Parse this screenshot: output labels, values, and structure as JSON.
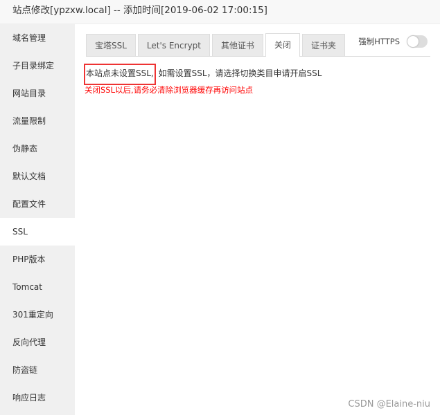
{
  "window": {
    "title": "站点修改[ypzxw.local] -- 添加时间[2019-06-02 17:00:15]"
  },
  "sidebar": {
    "items": [
      {
        "label": "域名管理"
      },
      {
        "label": "子目录绑定"
      },
      {
        "label": "网站目录"
      },
      {
        "label": "流量限制"
      },
      {
        "label": "伪静态"
      },
      {
        "label": "默认文档"
      },
      {
        "label": "配置文件"
      },
      {
        "label": "SSL",
        "active": true
      },
      {
        "label": "PHP版本"
      },
      {
        "label": "Tomcat"
      },
      {
        "label": "301重定向"
      },
      {
        "label": "反向代理"
      },
      {
        "label": "防盗链"
      },
      {
        "label": "响应日志"
      }
    ]
  },
  "tabs": [
    {
      "label": "宝塔SSL"
    },
    {
      "label": "Let's Encrypt"
    },
    {
      "label": "其他证书"
    },
    {
      "label": "关闭",
      "active": true
    },
    {
      "label": "证书夹"
    }
  ],
  "force_https": {
    "label": "强制HTTPS",
    "enabled": false
  },
  "content": {
    "highlighted": "本站点未设置SSL,",
    "message": "如需设置SSL，请选择切换类目申请开启SSL",
    "warning": "关闭SSL以后,请务必清除浏览器缓存再访问站点",
    "highlight_color": "#e33333",
    "warning_color": "#ff0000"
  },
  "watermark": "CSDN @Elaine-niu"
}
